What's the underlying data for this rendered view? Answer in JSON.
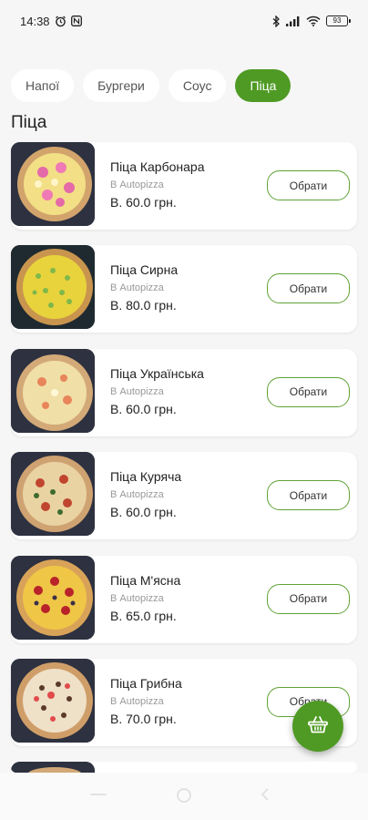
{
  "status_bar": {
    "time": "14:38",
    "battery": "93"
  },
  "tabs": [
    {
      "label": "Напої",
      "active": false
    },
    {
      "label": "Бургери",
      "active": false
    },
    {
      "label": "Соус",
      "active": false
    },
    {
      "label": "Піца",
      "active": true
    }
  ],
  "section_title": "Піца",
  "products": [
    {
      "name": "Піца Карбонара",
      "vendor": "В Autopizza",
      "price": "В. 60.0 грн.",
      "button": "Обрати"
    },
    {
      "name": "Піца Сирна",
      "vendor": "В Autopizza",
      "price": "В. 80.0 грн.",
      "button": "Обрати"
    },
    {
      "name": "Піца Українська",
      "vendor": "В Autopizza",
      "price": "В. 60.0 грн.",
      "button": "Обрати"
    },
    {
      "name": "Піца Куряча",
      "vendor": "В Autopizza",
      "price": "В. 60.0 грн.",
      "button": "Обрати"
    },
    {
      "name": "Піца М'ясна",
      "vendor": "В Autopizza",
      "price": "В. 65.0 грн.",
      "button": "Обрати"
    },
    {
      "name": "Піца Грибна",
      "vendor": "В Autopizza",
      "price": "В. 70.0 грн.",
      "button": "Обрати"
    }
  ],
  "colors": {
    "accent": "#4f9a24",
    "button_border": "#5fa233",
    "background": "#f6f6f6"
  },
  "icons": {
    "fab": "basket-icon"
  }
}
